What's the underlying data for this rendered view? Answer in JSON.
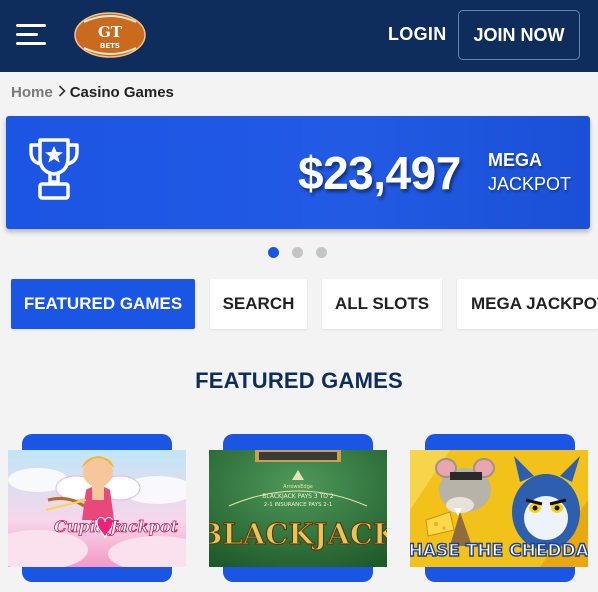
{
  "header": {
    "logo_text_top": "GT",
    "logo_text_bottom": "BETS",
    "login_label": "LOGIN",
    "join_label": "JOIN NOW",
    "menu_icon": "hamburger-icon",
    "bg_color": "#0e2c5c"
  },
  "breadcrumb": {
    "home": "Home",
    "separator_icon": "chevron-right-icon",
    "current": "Casino Games"
  },
  "banner": {
    "icon": "trophy-icon",
    "amount": "$23,497",
    "line1": "MEGA",
    "line2": "JACKPOT",
    "bg_color": "#1b55e3"
  },
  "carousel": {
    "active_index": 1,
    "count": 3
  },
  "tabs": [
    {
      "label": "FEATURED GAMES",
      "active": true
    },
    {
      "label": "SEARCH",
      "active": false
    },
    {
      "label": "ALL SLOTS",
      "active": false
    },
    {
      "label": "MEGA JACKPOTS",
      "active": false
    }
  ],
  "section_title": "FEATURED GAMES",
  "games": [
    {
      "name": "Cupid's Jackpot",
      "art_text_1": "Cupid's",
      "art_text_2": "Jackpot"
    },
    {
      "name": "Blackjack",
      "art_text": "BLACKJACK",
      "table_line1": "ArrowsEdge",
      "table_line2": "BLACKJACK PAYS 3 TO 2",
      "table_line3": "2-1 INSURANCE PAYS 2-1"
    },
    {
      "name": "Chase the Cheddar",
      "art_text": "CHASE THE CHEDDAR"
    }
  ],
  "colors": {
    "accent": "#1b55e3",
    "navy": "#0e2c5c",
    "page_bg": "#f3f3f3"
  }
}
